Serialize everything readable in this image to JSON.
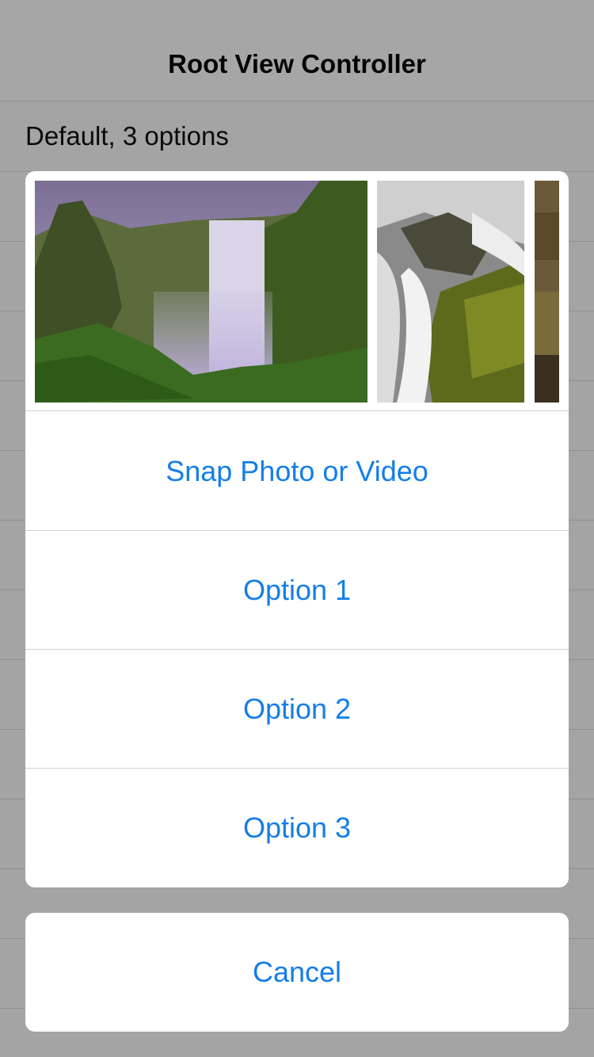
{
  "nav": {
    "title": "Root View Controller"
  },
  "table": {
    "rows": [
      "Default, 3 options"
    ]
  },
  "sheet": {
    "photos": [
      "waterfall-canyon-photo",
      "waterfall-rocks-photo",
      "partial-photo"
    ],
    "actions": [
      "Snap Photo or Video",
      "Option 1",
      "Option 2",
      "Option 3"
    ],
    "cancel": "Cancel"
  },
  "colors": {
    "accent": "#147ee8",
    "dim_background": "#a4a4a4"
  }
}
